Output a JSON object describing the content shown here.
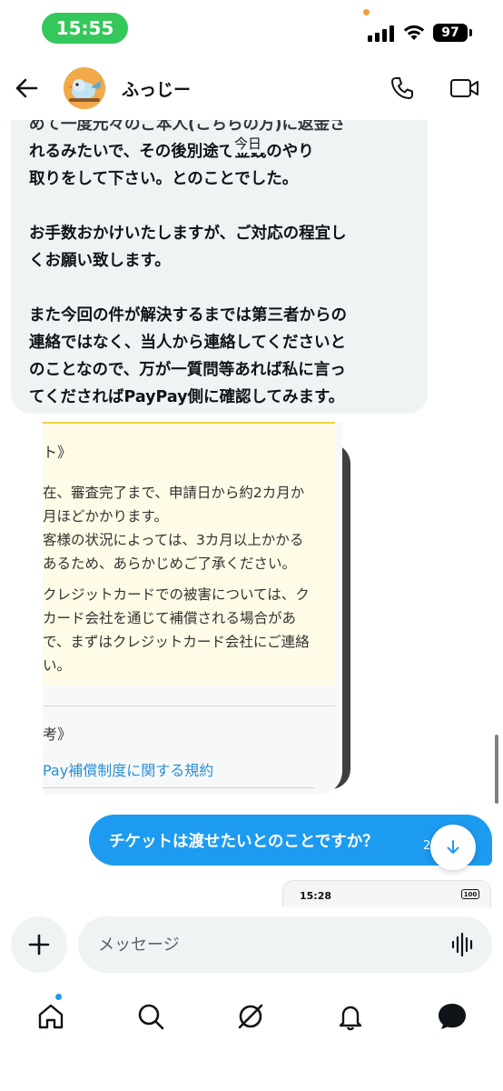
{
  "status_bar": {
    "time": "15:55",
    "battery": "97"
  },
  "header": {
    "contact_name": "ふっじー"
  },
  "conversation": {
    "incoming_lines_partial": "めて一度元々のご本人(こちらの方)に返金さ",
    "incoming_paragraphs": [
      [
        "れるみたいで、その後別途で金銭のやり",
        "取りをして下さい。とのことでした。"
      ],
      [
        "お手数おかけいたしますが、ご対応の程宜し",
        "くお願い致します。"
      ],
      [
        "また今回の件が解決するまでは第三者からの",
        "連絡ではなく、当人から連絡してくださいと",
        "のことなので、万が一質問等あれば私に言っ",
        "てくださればPayPay側に確認してみます。"
      ]
    ],
    "date_separator": "今日",
    "image_text": {
      "heading": "ト》",
      "lines": [
        "在、審査完了まで、申請日から約2カ月か",
        "月ほどかかります。",
        "客様の状況によっては、3カ月以上かかる",
        "あるため、あらかじめご了承ください。",
        "クレジットカードでの被害については、ク",
        "カード会社を通じて補償される場合があ",
        "で、まずはクレジットカード会社にご連絡",
        "い。"
      ],
      "heading2": "考》",
      "link": "Pay補償制度に関する規約"
    },
    "outgoing_message": "チケットは渡せたいとのことですか？",
    "outgoing_time_partial": "2",
    "preview": {
      "time": "15:28",
      "battery": "100"
    }
  },
  "composer": {
    "placeholder": "メッセージ"
  },
  "icons": {
    "back": "arrow-left-icon",
    "call": "phone-icon",
    "video": "video-camera-icon",
    "plus": "plus-icon",
    "voice": "voice-waveform-icon",
    "scroll_down": "arrow-down-icon",
    "nav": [
      "home-icon",
      "search-icon",
      "grok-icon",
      "bell-icon",
      "messages-icon"
    ]
  },
  "colors": {
    "accent": "#1d9bf0",
    "bubble_incoming": "#eff3f4",
    "status_pill": "#34c759",
    "yellow_box": "#fffbe6",
    "link": "#2b8fd6"
  }
}
